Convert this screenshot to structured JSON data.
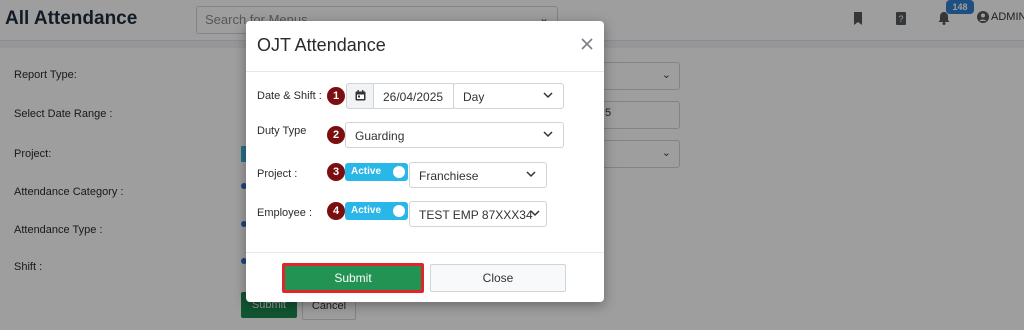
{
  "header": {
    "title": "All Attendance",
    "search_placeholder": "Search for Menus",
    "notification_count": "148",
    "user_label": "ADMIN"
  },
  "form": {
    "labels": {
      "report_type": "Report Type:",
      "date_range": "Select Date Range :",
      "project": "Project:",
      "attendance_category": "Attendance Category :",
      "attendance_type": "Attendance Type :",
      "shift": "Shift :"
    },
    "date_range_tail": "5",
    "submit_label": "Submit",
    "cancel_label": "Cancel"
  },
  "modal": {
    "title": "OJT Attendance",
    "rows": {
      "date_shift": {
        "label": "Date & Shift :",
        "step": "1",
        "date": "26/04/2025",
        "shift": "Day"
      },
      "duty_type": {
        "label": "Duty Type",
        "step": "2",
        "value": "Guarding"
      },
      "project": {
        "label": "Project :",
        "step": "3",
        "toggle": "Active",
        "value": "Franchiese"
      },
      "employee": {
        "label": "Employee :",
        "step": "4",
        "toggle": "Active",
        "value": "TEST EMP 87XXX34"
      }
    },
    "submit_label": "Submit",
    "close_label": "Close"
  },
  "colors": {
    "step_badge": "#7b0f10",
    "toggle_active": "#29b6e8",
    "submit": "#239353",
    "submit_highlight": "#e0262b"
  }
}
